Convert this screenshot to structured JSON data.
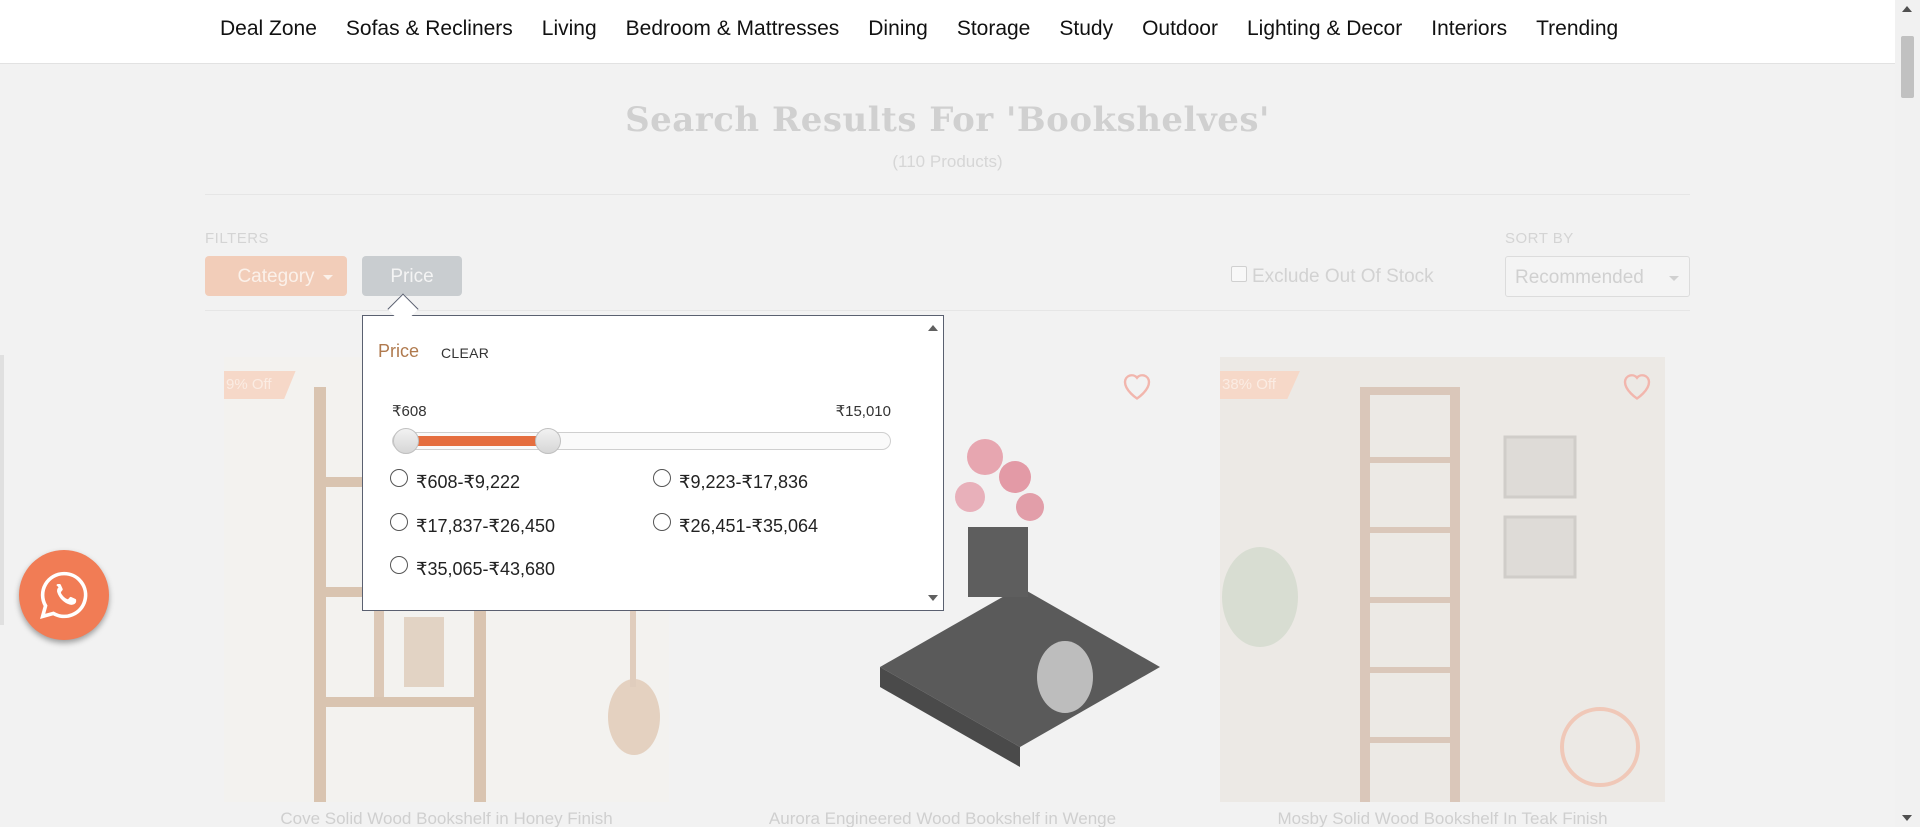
{
  "nav": {
    "items": [
      "Deal Zone",
      "Sofas & Recliners",
      "Living",
      "Bedroom & Mattresses",
      "Dining",
      "Storage",
      "Study",
      "Outdoor",
      "Lighting & Decor",
      "Interiors",
      "Trending"
    ]
  },
  "results": {
    "title": "Search Results For 'Bookshelves'",
    "count": "(110 Products)"
  },
  "filters": {
    "label": "FILTERS",
    "category_label": "Category",
    "price_label": "Price",
    "exclude_label": "Exclude Out Of Stock",
    "exclude_checked": false
  },
  "sort": {
    "label": "SORT BY",
    "value": "Recommended"
  },
  "products": [
    {
      "badge": "9% Off",
      "name": "Cove Solid Wood Bookshelf in Honey Finish"
    },
    {
      "badge": "",
      "name": "Aurora Engineered Wood Bookshelf in Wenge"
    },
    {
      "badge": "38% Off",
      "name": "Mosby Solid Wood Bookshelf In Teak Finish"
    }
  ],
  "price_popup": {
    "title": "Price",
    "clear_label": "CLEAR",
    "range_min": "₹608",
    "range_max": "₹15,010",
    "slider_low_fraction": 0.0,
    "slider_high_fraction": 0.3,
    "options": [
      "₹608-₹9,222",
      "₹9,223-₹17,836",
      "₹17,837-₹26,450",
      "₹26,451-₹35,064",
      "₹35,065-₹43,680"
    ]
  },
  "colors": {
    "accent": "#e56e3f",
    "whatsapp_button": "#f17c55",
    "price_title": "#b07a4e"
  },
  "icons": {
    "whatsapp": "whatsapp-icon",
    "favorite": "heart-outline-icon"
  }
}
